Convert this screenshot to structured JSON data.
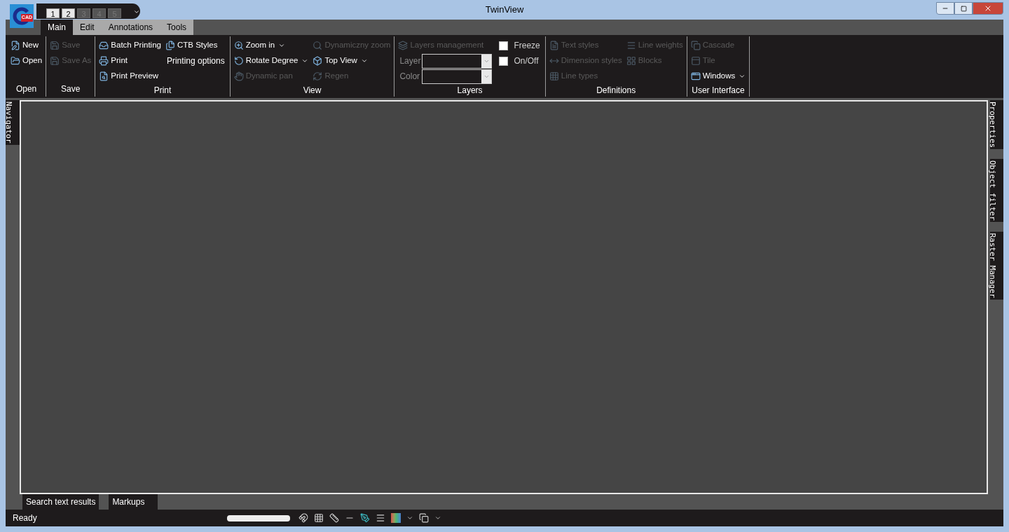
{
  "window": {
    "title": "TwinView"
  },
  "app_logo": {
    "badge": "CAD"
  },
  "quick_access": [
    {
      "key": "1",
      "disabled": false
    },
    {
      "key": "2",
      "disabled": false
    },
    {
      "key": "3",
      "disabled": true
    },
    {
      "key": "4",
      "disabled": true
    },
    {
      "key": "5",
      "disabled": true
    }
  ],
  "tabs": [
    {
      "label": "Main",
      "selected": true
    },
    {
      "label": "Edit",
      "selected": false
    },
    {
      "label": "Annotations",
      "selected": false
    },
    {
      "label": "Tools",
      "selected": false
    }
  ],
  "ribbon_groups": [
    {
      "label": "Open",
      "columns": [
        [
          {
            "kind": "button",
            "label": "New",
            "disabled": false
          },
          {
            "kind": "button",
            "label": "Open",
            "disabled": false
          }
        ]
      ]
    },
    {
      "label": "Save",
      "columns": [
        [
          {
            "kind": "button",
            "label": "Save",
            "disabled": true
          },
          {
            "kind": "button",
            "label": "Save As",
            "disabled": true
          }
        ]
      ]
    },
    {
      "label": "Print",
      "columns": [
        [
          {
            "kind": "button",
            "label": "Batch Printing",
            "disabled": false
          },
          {
            "kind": "button",
            "label": "Print",
            "disabled": false
          },
          {
            "kind": "button",
            "label": "Print Preview",
            "disabled": false
          }
        ],
        [
          {
            "kind": "button",
            "label": "CTB Styles",
            "disabled": false
          },
          {
            "kind": "text_button",
            "label": "Printing options",
            "disabled": false
          }
        ]
      ]
    },
    {
      "label": "View",
      "columns": [
        [
          {
            "kind": "button",
            "label": "Zoom in",
            "disabled": false,
            "dropdown": true
          },
          {
            "kind": "button",
            "label": "Rotate Degree",
            "disabled": false,
            "dropdown": true
          },
          {
            "kind": "button",
            "label": "Dynamic pan",
            "disabled": true
          }
        ],
        [
          {
            "kind": "button",
            "label": "Dynamiczny zoom",
            "disabled": true
          },
          {
            "kind": "button",
            "label": "Top View",
            "disabled": false,
            "dropdown": true
          },
          {
            "kind": "button",
            "label": "Regen",
            "disabled": true
          }
        ]
      ]
    },
    {
      "label": "Layers",
      "columns": [
        [
          {
            "kind": "button",
            "label": "Layers management",
            "disabled": true
          },
          {
            "kind": "combo",
            "label": "Layer",
            "disabled": false
          },
          {
            "kind": "combo",
            "label": "Color",
            "disabled": false
          }
        ],
        [
          {
            "kind": "checkbox",
            "label": "Freeze",
            "checked": false
          },
          {
            "kind": "checkbox",
            "label": "On/Off",
            "checked": false
          }
        ]
      ]
    },
    {
      "label": "Definitions",
      "columns": [
        [
          {
            "kind": "button",
            "label": "Text styles",
            "disabled": true
          },
          {
            "kind": "button",
            "label": "Dimension styles",
            "disabled": true
          },
          {
            "kind": "button",
            "label": "Line types",
            "disabled": true
          }
        ],
        [
          {
            "kind": "button",
            "label": "Line weights",
            "disabled": true
          },
          {
            "kind": "button",
            "label": "Blocks",
            "disabled": true
          }
        ]
      ]
    },
    {
      "label": "User Interface",
      "columns": [
        [
          {
            "kind": "button",
            "label": "Cascade",
            "disabled": true
          },
          {
            "kind": "button",
            "label": "Tile",
            "disabled": true
          },
          {
            "kind": "button",
            "label": "Windows",
            "disabled": false,
            "dropdown": true
          }
        ]
      ]
    }
  ],
  "left_panel_tabs": [
    {
      "label": "Navigator"
    }
  ],
  "right_panel_tabs": [
    {
      "label": "Properties"
    },
    {
      "label": "Object filter"
    },
    {
      "label": "Raster Manager"
    }
  ],
  "bottom_tabs": [
    {
      "label": "Search text results",
      "selected": false
    },
    {
      "label": "Markups",
      "selected": false
    }
  ],
  "status_bar": {
    "text": "Ready"
  }
}
